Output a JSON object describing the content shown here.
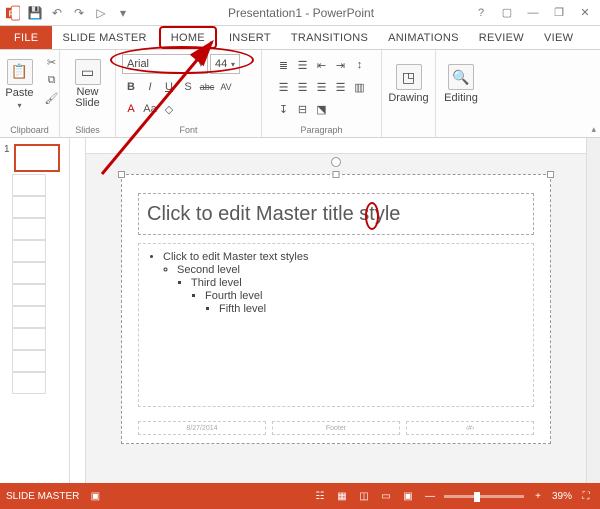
{
  "title": "Presentation1 - PowerPoint",
  "qat": {
    "save": "💾",
    "undo": "↶",
    "redo": "↷",
    "start": "▷",
    "more": "▾"
  },
  "tabs": {
    "file": "FILE",
    "items": [
      "SLIDE MASTER",
      "HOME",
      "INSERT",
      "TRANSITIONS",
      "ANIMATIONS",
      "REVIEW",
      "VIEW"
    ],
    "active": "HOME"
  },
  "ribbon": {
    "clipboard": {
      "paste": "Paste",
      "label": "Clipboard"
    },
    "slides": {
      "new_slide": "New\nSlide",
      "label": "Slides"
    },
    "font": {
      "name": "Arial",
      "size": "44",
      "bold": "B",
      "italic": "I",
      "underline": "U",
      "shadow": "S",
      "strike": "abc",
      "spacing": "AV",
      "font_color": "A",
      "highlight": "Aa",
      "label": "Font"
    },
    "paragraph": {
      "label": "Paragraph"
    },
    "drawing": {
      "label": "Drawing"
    },
    "editing": {
      "label": "Editing"
    }
  },
  "thumbs": {
    "current": "1"
  },
  "slide": {
    "title_placeholder": "Click to edit Master title style",
    "body": {
      "l1": "Click to edit Master text styles",
      "l2": "Second level",
      "l3": "Third level",
      "l4": "Fourth level",
      "l5": "Fifth level"
    },
    "footer": {
      "date": "8/27/2014",
      "center": "Footer",
      "num": "‹#›"
    }
  },
  "status": {
    "mode": "SLIDE MASTER",
    "zoom": "39%"
  },
  "winbtns": {
    "help": "?",
    "ribbon_opts": "▢",
    "min": "—",
    "restore": "❐",
    "close": "✕"
  }
}
